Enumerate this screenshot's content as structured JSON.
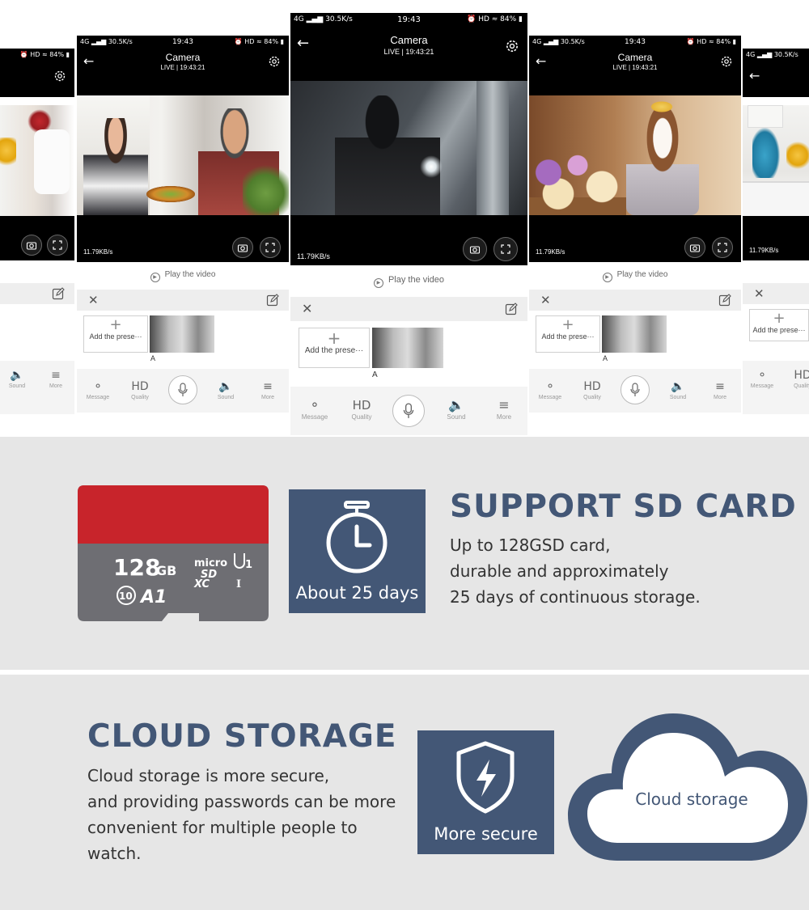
{
  "app": {
    "network": "4G",
    "speed": "30.5K/s",
    "time": "19:43",
    "battery": "84%",
    "signal_hd": "HD",
    "title": "Camera",
    "live": "LIVE | 19:43:21",
    "bitrate": "11.79KB/s",
    "play_video": "Play the video",
    "add_preset": "Add the prese···",
    "preset_label": "A",
    "bottom": {
      "message": "Message",
      "quality_icon": "HD",
      "quality": "Quality",
      "sound": "Sound",
      "more": "More"
    }
  },
  "sd": {
    "heading": "SUPPORT SD CARD",
    "lines": [
      "Up to 128GSD card,",
      "durable and approximately",
      "25 days of continuous storage."
    ],
    "tile_label": "About 25 days",
    "card": {
      "capacity": "128",
      "unit": "GB",
      "brand1": "micro",
      "brand2": "SD",
      "xc": "XC",
      "uhs": "1",
      "uhs_roman": "I",
      "class": "10",
      "app_class": "A1"
    }
  },
  "cloud": {
    "heading": "CLOUD STORAGE",
    "lines": [
      "Cloud storage is more secure,",
      "and providing passwords can be more",
      "convenient for multiple people to",
      "watch."
    ],
    "tile_label": "More secure",
    "cloud_label": "Cloud storage"
  },
  "colors": {
    "accent": "#435776",
    "card_red": "#c8242b",
    "card_gray": "#6e6e73",
    "section_bg": "#e6e6e6"
  }
}
